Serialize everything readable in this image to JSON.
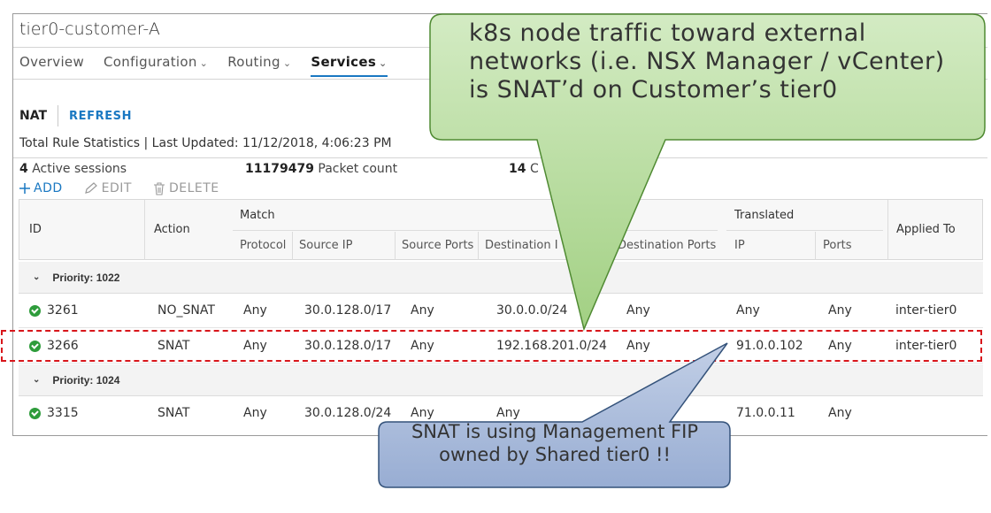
{
  "window": {
    "title": "tier0-customer-A"
  },
  "tabs": [
    {
      "label": "Overview",
      "chevron": false,
      "active": false
    },
    {
      "label": "Configuration",
      "chevron": true,
      "active": false
    },
    {
      "label": "Routing",
      "chevron": true,
      "active": false
    },
    {
      "label": "Services",
      "chevron": true,
      "active": true
    }
  ],
  "nat": {
    "label": "NAT",
    "refresh_label": "REFRESH"
  },
  "stats": {
    "summary": "Total Rule Statistics | Last Updated: 11/12/2018, 4:06:23 PM",
    "active_sessions_count": "4",
    "active_sessions_label": "Active sessions",
    "packet_count_value": "11179479",
    "packet_count_label": "Packet count",
    "third_value": "14",
    "third_label": "C"
  },
  "toolbar": {
    "add_label": "ADD",
    "edit_label": "EDIT",
    "delete_label": "DELETE"
  },
  "table": {
    "headers": {
      "id": "ID",
      "action": "Action",
      "match": "Match",
      "protocol": "Protocol",
      "source_ip": "Source IP",
      "source_ports": "Source Ports",
      "destination_ip": "Destination I",
      "destination_ports": "Destination Ports",
      "translated": "Translated",
      "ip": "IP",
      "ports": "Ports",
      "applied_to": "Applied To"
    },
    "groups": [
      {
        "label": "Priority: 1022",
        "rows": [
          {
            "id": "3261",
            "action": "NO_SNAT",
            "protocol": "Any",
            "source_ip": "30.0.128.0/17",
            "source_ports": "Any",
            "destination_ip": "30.0.0.0/24",
            "destination_ports": "Any",
            "translated_ip": "Any",
            "translated_ports": "Any",
            "applied_to": "inter-tier0"
          },
          {
            "id": "3266",
            "action": "SNAT",
            "protocol": "Any",
            "source_ip": "30.0.128.0/17",
            "source_ports": "Any",
            "destination_ip": "192.168.201.0/24",
            "destination_ports": "Any",
            "translated_ip": "91.0.0.102",
            "translated_ports": "Any",
            "applied_to": "inter-tier0"
          }
        ]
      },
      {
        "label": "Priority: 1024",
        "rows": [
          {
            "id": "3315",
            "action": "SNAT",
            "protocol": "Any",
            "source_ip": "30.0.128.0/24",
            "source_ports": "Any",
            "destination_ip": "Any",
            "destination_ports": "",
            "translated_ip": "71.0.0.11",
            "translated_ports": "Any",
            "applied_to": ""
          }
        ]
      }
    ]
  },
  "callouts": {
    "green": "k8s node traffic toward external networks (i.e. NSX Manager / vCenter) is SNAT’d on Customer’s tier0",
    "blue": "SNAT is using Management FIP owned by Shared tier0 !!"
  },
  "colors": {
    "accent": "#1a78c2",
    "status_ok": "#2e9c3b",
    "highlight": "#d8161b",
    "callout_green": "#a8d48b",
    "callout_blue": "#9bb0d4"
  }
}
